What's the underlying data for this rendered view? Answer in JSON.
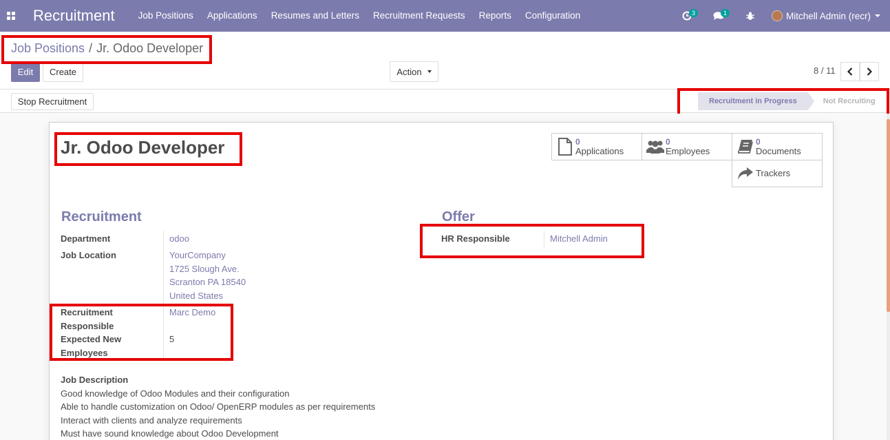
{
  "navbar": {
    "brand": "Recruitment",
    "menu": [
      "Job Positions",
      "Applications",
      "Resumes and Letters",
      "Recruitment Requests",
      "Reports",
      "Configuration"
    ],
    "activity_badge": "3",
    "messages_badge": "1",
    "user": "Mitchell Admin (recr)"
  },
  "breadcrumb": {
    "parent": "Job Positions",
    "separator": "/",
    "current": "Jr. Odoo Developer"
  },
  "buttons": {
    "edit": "Edit",
    "create": "Create",
    "action": "Action",
    "stop_recruitment": "Stop Recruitment"
  },
  "pager": {
    "value": "8 / 11"
  },
  "stages": {
    "active": "Recruitment in Progress",
    "inactive": "Not Recruiting"
  },
  "record": {
    "title": "Jr. Odoo Developer"
  },
  "smart_buttons": {
    "applications": {
      "count": "0",
      "label": "Applications"
    },
    "employees": {
      "count": "0",
      "label": "Employees"
    },
    "documents": {
      "count": "0",
      "label": "Documents"
    },
    "trackers": {
      "label": "Trackers"
    }
  },
  "recruitment": {
    "title": "Recruitment",
    "department_label": "Department",
    "department_value": "odoo",
    "job_location_label": "Job Location",
    "job_location_lines": [
      "YourCompany",
      "1725 Slough Ave.",
      "Scranton PA 18540",
      "United States"
    ],
    "recruitment_responsible_label_1": "Recruitment",
    "recruitment_responsible_label_2": "Responsible",
    "recruitment_responsible_value": "Marc Demo",
    "expected_label_1": "Expected New",
    "expected_label_2": "Employees",
    "expected_value": "5"
  },
  "offer": {
    "title": "Offer",
    "hr_responsible_label": "HR Responsible",
    "hr_responsible_value": "Mitchell Admin"
  },
  "job_description": {
    "label": "Job Description",
    "lines": [
      "Good knowledge of Odoo Modules and their configuration",
      "Able to handle customization on Odoo/ OpenERP modules as per requirements",
      "Interact with clients and analyze requirements",
      "Must have sound knowledge about Odoo Development"
    ]
  },
  "colors": {
    "brand": "#7c7bad",
    "highlight": "#e50000"
  }
}
